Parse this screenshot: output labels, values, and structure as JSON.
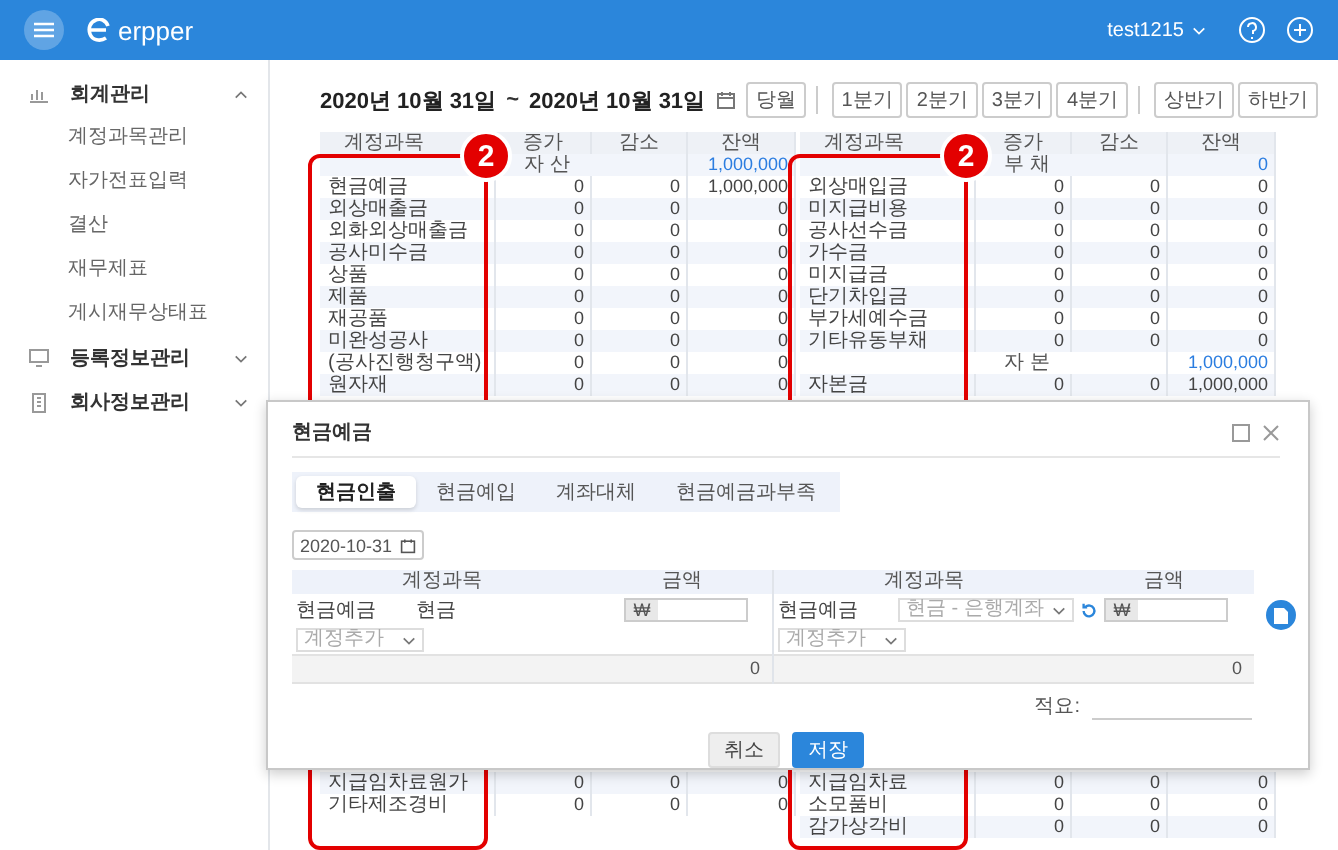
{
  "header": {
    "logo": "erpper",
    "user": "test1215"
  },
  "sidebar": {
    "items": [
      {
        "label": "회계관리",
        "expanded": true,
        "children": [
          {
            "label": "계정과목관리"
          },
          {
            "label": "자가전표입력"
          },
          {
            "label": "결산"
          },
          {
            "label": "재무제표"
          },
          {
            "label": "게시재무상태표"
          }
        ]
      },
      {
        "label": "등록정보관리",
        "expanded": false
      },
      {
        "label": "회사정보관리",
        "expanded": false
      }
    ]
  },
  "period": {
    "from": "2020년 10월 31일",
    "separator": "~",
    "to": "2020년 10월 31일",
    "button_groups": [
      {
        "buttons": [
          "당월"
        ]
      },
      {
        "buttons": [
          "1분기",
          "2분기",
          "3분기",
          "4분기"
        ]
      },
      {
        "buttons": [
          "상반기",
          "하반기"
        ]
      }
    ]
  },
  "balance_table": {
    "panels": [
      {
        "columns": [
          "계정과목",
          "증가",
          "감소",
          "잔액"
        ],
        "annotation": "2",
        "groups": [
          {
            "label": "자 산",
            "balance": "1,000,000",
            "rows": [
              {
                "account": "현금예금",
                "increase": "0",
                "decrease": "0",
                "balance": "1,000,000"
              },
              {
                "account": "외상매출금",
                "increase": "0",
                "decrease": "0",
                "balance": "0"
              },
              {
                "account": "외화외상매출금",
                "increase": "0",
                "decrease": "0",
                "balance": "0"
              },
              {
                "account": "공사미수금",
                "increase": "0",
                "decrease": "0",
                "balance": "0"
              },
              {
                "account": "상품",
                "increase": "0",
                "decrease": "0",
                "balance": "0"
              },
              {
                "account": "제품",
                "increase": "0",
                "decrease": "0",
                "balance": "0"
              },
              {
                "account": "재공품",
                "increase": "0",
                "decrease": "0",
                "balance": "0"
              },
              {
                "account": "미완성공사",
                "increase": "0",
                "decrease": "0",
                "balance": "0"
              },
              {
                "account": "(공사진행청구액)",
                "increase": "0",
                "decrease": "0",
                "balance": "0"
              },
              {
                "account": "원자재",
                "increase": "0",
                "decrease": "0",
                "balance": "0"
              }
            ]
          }
        ],
        "rows_below": [
          {
            "account": "지급임차료원가",
            "increase": "0",
            "decrease": "0",
            "balance": "0"
          },
          {
            "account": "기타제조경비",
            "increase": "0",
            "decrease": "0",
            "balance": "0"
          }
        ]
      },
      {
        "columns": [
          "계정과목",
          "증가",
          "감소",
          "잔액"
        ],
        "annotation": "2",
        "groups": [
          {
            "label": "부 채",
            "balance": "0",
            "rows": [
              {
                "account": "외상매입금",
                "increase": "0",
                "decrease": "0",
                "balance": "0"
              },
              {
                "account": "미지급비용",
                "increase": "0",
                "decrease": "0",
                "balance": "0"
              },
              {
                "account": "공사선수금",
                "increase": "0",
                "decrease": "0",
                "balance": "0"
              },
              {
                "account": "가수금",
                "increase": "0",
                "decrease": "0",
                "balance": "0"
              },
              {
                "account": "미지급금",
                "increase": "0",
                "decrease": "0",
                "balance": "0"
              },
              {
                "account": "단기차입금",
                "increase": "0",
                "decrease": "0",
                "balance": "0"
              },
              {
                "account": "부가세예수금",
                "increase": "0",
                "decrease": "0",
                "balance": "0"
              },
              {
                "account": "기타유동부채",
                "increase": "0",
                "decrease": "0",
                "balance": "0"
              }
            ]
          },
          {
            "label": "자 본",
            "balance": "1,000,000",
            "rows": [
              {
                "account": "자본금",
                "increase": "0",
                "decrease": "0",
                "balance": "1,000,000"
              }
            ]
          }
        ],
        "rows_below": [
          {
            "account": "지급임차료",
            "increase": "0",
            "decrease": "0",
            "balance": "0"
          },
          {
            "account": "소모품비",
            "increase": "0",
            "decrease": "0",
            "balance": "0"
          },
          {
            "account": "감가상각비",
            "increase": "0",
            "decrease": "0",
            "balance": "0"
          }
        ]
      }
    ]
  },
  "dialog": {
    "title": "현금예금",
    "tabs": [
      {
        "label": "현금인출",
        "selected": true
      },
      {
        "label": "현금예입",
        "selected": false
      },
      {
        "label": "계좌대체",
        "selected": false
      },
      {
        "label": "현금예금과부족",
        "selected": false
      }
    ],
    "date": "2020-10-31",
    "sides": [
      {
        "columns": [
          "계정과목",
          "금액"
        ],
        "entry": {
          "kind": "text",
          "account": "현금예금",
          "detail": "현금",
          "currency": "₩"
        },
        "add_placeholder": "계정추가",
        "total": "0"
      },
      {
        "columns": [
          "계정과목",
          "금액"
        ],
        "entry": {
          "kind": "select",
          "account": "현금예금",
          "placeholder": "현금 - 은행계좌",
          "currency": "₩"
        },
        "add_placeholder": "계정추가",
        "total": "0"
      }
    ],
    "memo_label": "적요:",
    "buttons": [
      {
        "label": "취소",
        "kind": "secondary"
      },
      {
        "label": "저장",
        "kind": "primary"
      }
    ]
  }
}
